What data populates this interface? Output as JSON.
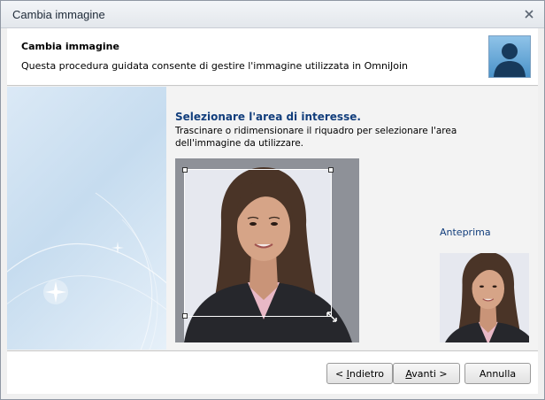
{
  "window": {
    "title": "Cambia immagine"
  },
  "header": {
    "title": "Cambia immagine",
    "description": "Questa procedura guidata consente di gestire l'immagine utilizzata in OmniJoin"
  },
  "content": {
    "section_title": "Selezionare l'area di interesse.",
    "section_desc": "Trascinare o ridimensionare il riquadro per selezionare l'area dell'immagine da utilizzare.",
    "preview_label": "Anteprima"
  },
  "footer": {
    "back_prefix": "< ",
    "back_mnemonic": "I",
    "back_rest": "ndietro",
    "next_mnemonic": "A",
    "next_rest": "vanti >",
    "cancel_label": "Annulla"
  },
  "colors": {
    "accent_title": "#123e7c",
    "window_bg": "#f0f0f0",
    "crop_bg": "#8e9198"
  },
  "icons": {
    "close": "close-icon",
    "avatar": "user-silhouette-icon",
    "resize": "resize-diagonal-icon"
  }
}
